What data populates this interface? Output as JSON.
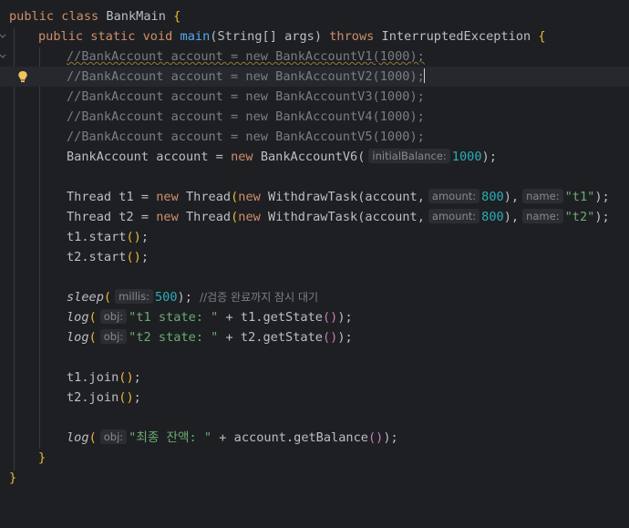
{
  "editor": {
    "lines": [
      {
        "kw1": "public class",
        "cls": "BankMain",
        "br": "{"
      },
      {
        "kw1": "public static void",
        "fn": "main",
        "params": "(String[] args)",
        "kw2": "throws",
        "exc": "InterruptedException",
        "br": "{"
      },
      {
        "comment": "//BankAccount account = new BankAccountV1(1000);"
      },
      {
        "comment": "//BankAccount account = new BankAccountV2(1000);"
      },
      {
        "comment": "//BankAccount account = new BankAccountV3(1000);"
      },
      {
        "comment": "//BankAccount account = new BankAccountV4(1000);"
      },
      {
        "comment": "//BankAccount account = new BankAccountV5(1000);"
      },
      {
        "type": "BankAccount account =",
        "kw": "new",
        "ctor": "BankAccountV6(",
        "hint": "initialBalance:",
        "num": "1000",
        "tail": ");"
      },
      {
        "t": "Thread t1 =",
        "kw": "new",
        "cls": "Thread",
        "kw2": "new",
        "cls2": "WithdrawTask",
        "args1": "(account,",
        "hint1": "amount:",
        "num": "800",
        "sep": "),",
        "hint2": "name:",
        "str": "\"t1\"",
        "tail": ");"
      },
      {
        "t": "Thread t2 =",
        "kw": "new",
        "cls": "Thread",
        "kw2": "new",
        "cls2": "WithdrawTask",
        "args1": "(account,",
        "hint1": "amount:",
        "num": "800",
        "sep": "),",
        "hint2": "name:",
        "str": "\"t2\"",
        "tail": ");"
      },
      {
        "code": "t1.start",
        "br": "()",
        "tail": ";"
      },
      {
        "code": "t2.start",
        "br": "()",
        "tail": ";"
      },
      {
        "fn": "sleep",
        "hint": "millis:",
        "num": "500",
        "tail": ");",
        "comment": "//검증 완료까지 잠시 대기"
      },
      {
        "fn": "log",
        "hint": "obj:",
        "str": "\"t1 state: \"",
        "mid": " + t1.getState",
        "br": "()",
        "tail": ");"
      },
      {
        "fn": "log",
        "hint": "obj:",
        "str": "\"t2 state: \"",
        "mid": " + t2.getState",
        "br": "()",
        "tail": ");"
      },
      {
        "code": "t1.join",
        "br": "()",
        "tail": ";"
      },
      {
        "code": "t2.join",
        "br": "()",
        "tail": ";"
      },
      {
        "fn": "log",
        "hint": "obj:",
        "str": "\"최종 잔액: \"",
        "mid": " + account.getBalance",
        "br": "()",
        "tail": ");"
      },
      {
        "close": "}"
      },
      {
        "close": "}"
      }
    ]
  }
}
